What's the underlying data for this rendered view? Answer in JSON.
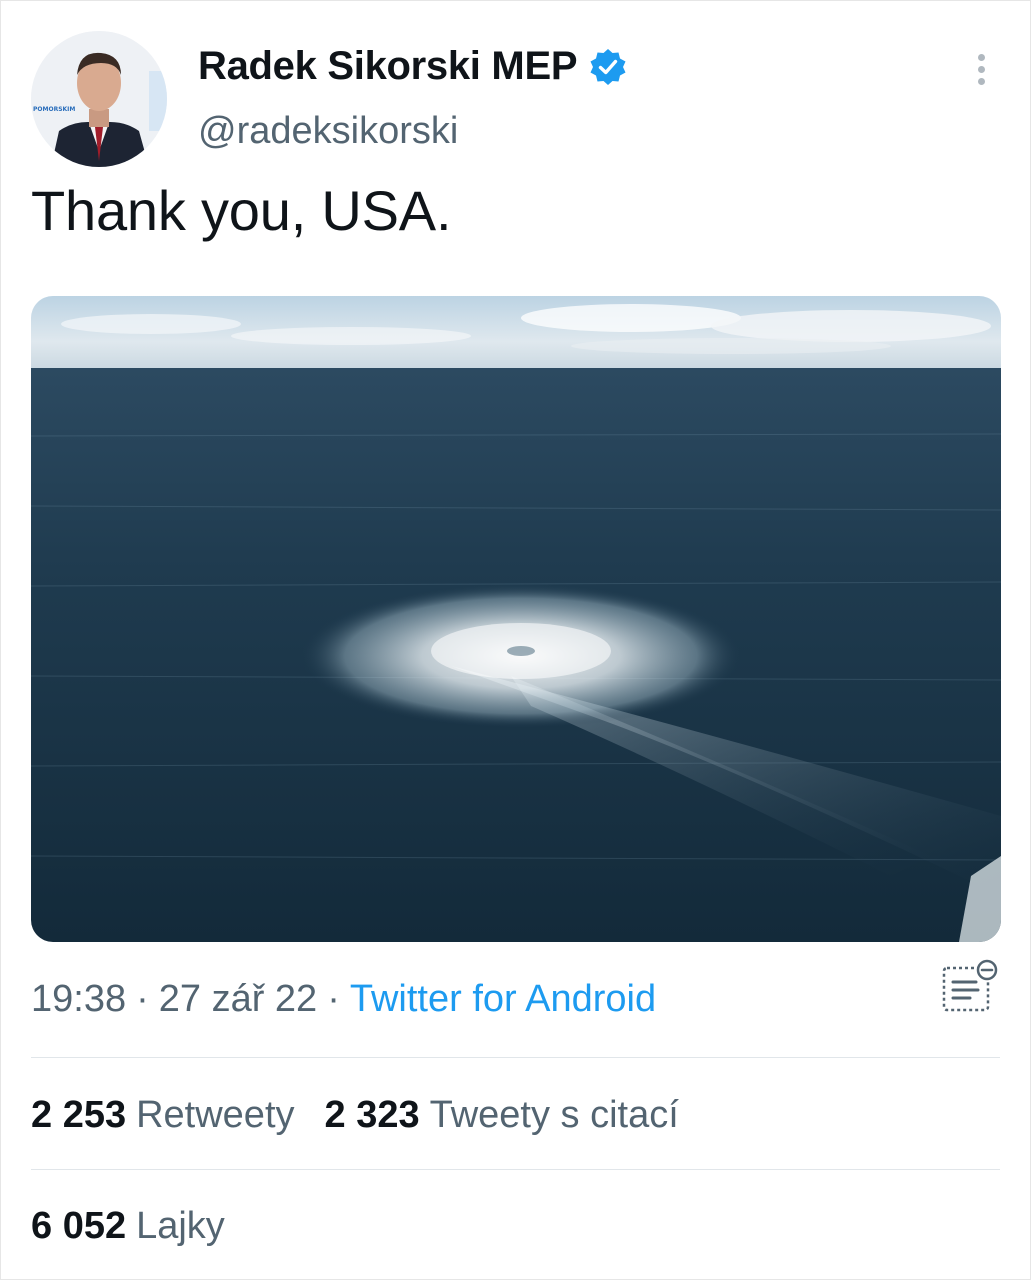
{
  "author": {
    "name": "Radek Sikorski MEP",
    "handle": "@radeksikorski",
    "verified": true,
    "avatar_label": "POMORSKIM"
  },
  "tweet": {
    "text": "Thank you, USA.",
    "time": "19:38",
    "date": "27 zář 22",
    "separator": "·",
    "source": "Twitter for Android"
  },
  "stats": {
    "retweets_count": "2 253",
    "retweets_label": "Retweety",
    "quotes_count": "2 323",
    "quotes_label": "Tweety s citací",
    "likes_count": "6 052",
    "likes_label": "Lajky"
  },
  "colors": {
    "text": "#0f1419",
    "secondary_text": "#536471",
    "link": "#1d9bf0",
    "verified_badge": "#1d9bf0",
    "divider": "#e1e6ea",
    "sea": "#1f3b4f"
  },
  "icons": {
    "verified": "verified-badge-icon",
    "more": "more-vertical-icon",
    "notes": "notes-icon"
  }
}
